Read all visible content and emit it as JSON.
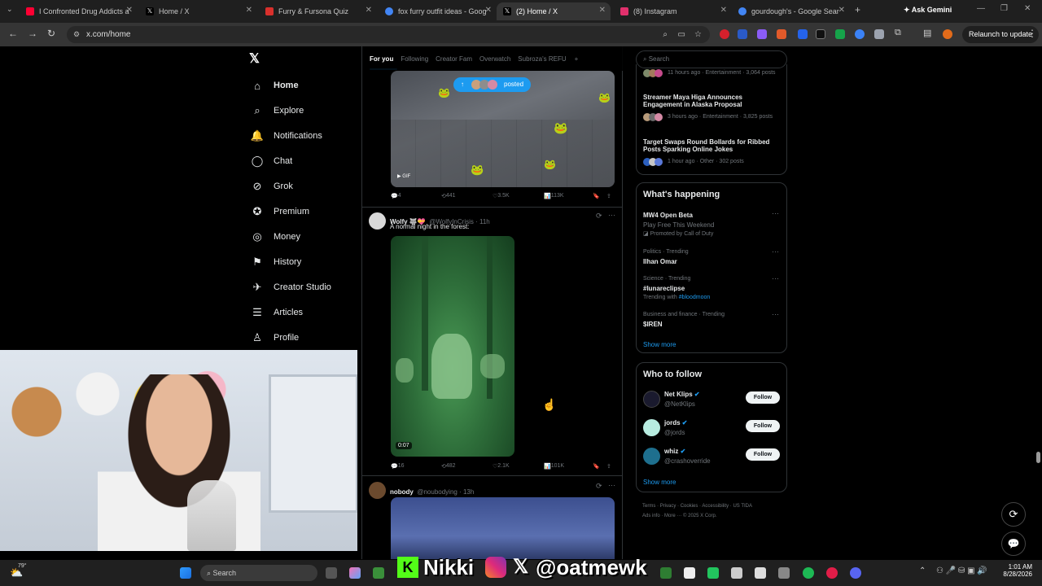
{
  "browser": {
    "tabs": [
      {
        "title": "I Confronted Drug Addicts a",
        "color": "#ff0033"
      },
      {
        "title": "Home / X",
        "color": "#ffffff"
      },
      {
        "title": "Furry & Fursona Quiz",
        "color": "#d9302c"
      },
      {
        "title": "fox furry outfit ideas - Goog",
        "color": "#4285f4"
      },
      {
        "title": "(2) Home / X",
        "color": "#ffffff"
      },
      {
        "title": "(8) Instagram",
        "color": "#e1306c"
      },
      {
        "title": "gourdough's - Google Sear",
        "color": "#4285f4"
      }
    ],
    "ask_gemini": "Ask Gemini",
    "url": "x.com/home",
    "relaunch": "Relaunch to update"
  },
  "nav": {
    "items": [
      {
        "label": "Home",
        "icon": "home-icon"
      },
      {
        "label": "Explore",
        "icon": "search-icon"
      },
      {
        "label": "Notifications",
        "icon": "bell-icon"
      },
      {
        "label": "Chat",
        "icon": "chat-icon"
      },
      {
        "label": "Grok",
        "icon": "grok-icon"
      },
      {
        "label": "Premium",
        "icon": "premium-icon"
      },
      {
        "label": "Money",
        "icon": "money-icon"
      },
      {
        "label": "History",
        "icon": "bookmark-icon"
      },
      {
        "label": "Creator Studio",
        "icon": "rocket-icon"
      },
      {
        "label": "Articles",
        "icon": "articles-icon"
      },
      {
        "label": "Profile",
        "icon": "person-icon"
      }
    ]
  },
  "feed": {
    "tabs": [
      "For you",
      "Following",
      "Creator Fam",
      "Overwatch",
      "Subroza's REFU"
    ],
    "posted_pill": "posted",
    "gif_badge": "GIF",
    "post1_stats": {
      "replies": "4",
      "reposts": "441",
      "likes": "3.5K",
      "views": "113K"
    },
    "post2": {
      "name": "Wolfy 🐺💝",
      "handle": "@WolfyInCrisis · 11h",
      "text": "A normal night in the forest:",
      "duration": "0:07",
      "stats": {
        "replies": "16",
        "reposts": "482",
        "likes": "2.1K",
        "views": "101K"
      }
    },
    "post3": {
      "name": "nobody",
      "handle": "@noubodying · 13h"
    }
  },
  "right": {
    "search_placeholder": "Search",
    "news": [
      {
        "meta": "11 hours ago · Entertainment · 3,064 posts",
        "title": ""
      },
      {
        "title": "Streamer Maya Higa Announces Engagement in Alaska Proposal",
        "meta": "3 hours ago · Entertainment · 3,825 posts"
      },
      {
        "title": "Target Swaps Round Bollards for Ribbed Posts Sparking Online Jokes",
        "meta": "1 hour ago · Other · 302 posts"
      }
    ],
    "happening": {
      "title": "What's happening",
      "items": [
        {
          "title": "MW4 Open Beta",
          "sub": "Play Free This Weekend",
          "meta": "Promoted by Call of Duty"
        },
        {
          "meta": "Politics · Trending",
          "title": "Ilhan Omar"
        },
        {
          "meta": "Science · Trending",
          "title": "#lunareclipse",
          "sub_prefix": "Trending with",
          "sub_link": "#bloodmoon"
        },
        {
          "meta": "Business and finance · Trending",
          "title": "$IREN"
        }
      ],
      "show_more": "Show more"
    },
    "who_to_follow": {
      "title": "Who to follow",
      "people": [
        {
          "name": "Net Klips",
          "handle": "@NetKlips",
          "button": "Follow"
        },
        {
          "name": "jords",
          "handle": "@jords",
          "button": "Follow"
        },
        {
          "name": "whiz",
          "handle": "@crashoverride",
          "button": "Follow"
        }
      ],
      "show_more": "Show more"
    },
    "footer": {
      "line1": [
        "Terms",
        "Privacy",
        "Cookies",
        "Accessibility",
        "US TIDA"
      ],
      "line2": [
        "Ads info",
        "More ···",
        "© 2025 X Corp."
      ]
    }
  },
  "taskbar": {
    "weather": "79°",
    "search_placeholder": "Search",
    "time": "1:01 AM",
    "date": "8/28/2026"
  },
  "overlay": {
    "name": "Nikki",
    "handle": "@oatmewk"
  }
}
